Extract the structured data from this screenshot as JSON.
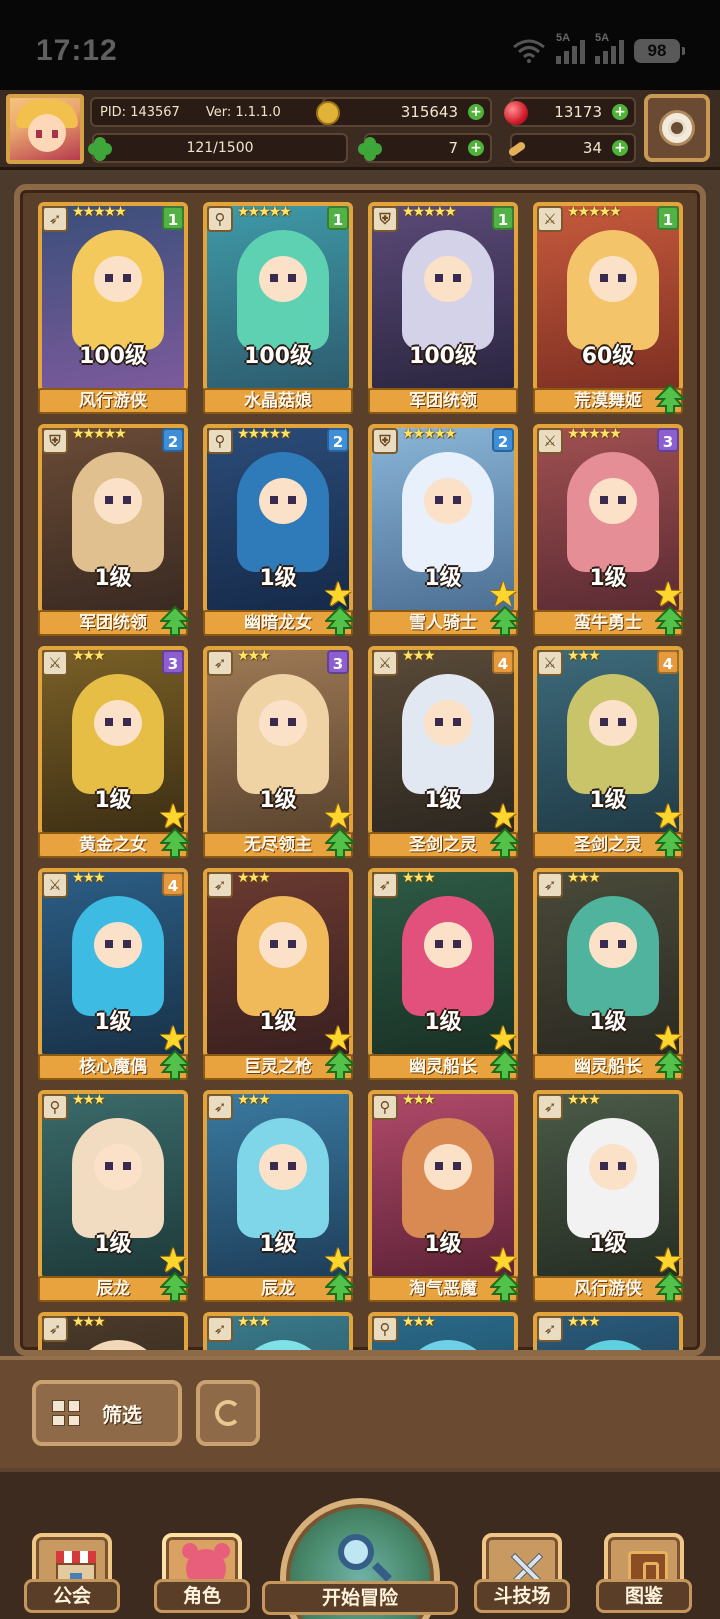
{
  "status_bar": {
    "time": "17:12",
    "sim1_label": "5A",
    "sim2_label": "5A",
    "battery": "98"
  },
  "header": {
    "pid": "PID: 143567",
    "version": "Ver: 1.1.1.0",
    "exp": "121/1500",
    "gold": "315643",
    "gems": "13173",
    "clovers": "7",
    "bones": "34",
    "plus": "+"
  },
  "heroes": [
    {
      "stars": "★★★★★",
      "tier": "1",
      "tier_class": "t1",
      "level": "100级",
      "name": "风行游侠",
      "role_icon": "bow-icon",
      "bg": [
        "#3a4f7a",
        "#7c5a9c"
      ],
      "hair": "#f3c95b",
      "upgradable": false,
      "star_ready": false,
      "upgrade_arrow": false
    },
    {
      "stars": "★★★★★",
      "tier": "1",
      "tier_class": "t1",
      "level": "100级",
      "name": "水晶菇娘",
      "role_icon": "staff-icon",
      "bg": [
        "#3f9aa8",
        "#2d5c6e"
      ],
      "hair": "#5fd1b3",
      "upgradable": false,
      "star_ready": false,
      "upgrade_arrow": false
    },
    {
      "stars": "★★★★★",
      "tier": "1",
      "tier_class": "t1",
      "level": "100级",
      "name": "军团统领",
      "role_icon": "shield-icon",
      "bg": [
        "#5b4a78",
        "#2b2640"
      ],
      "hair": "#d4d2e8",
      "upgradable": false,
      "star_ready": false,
      "upgrade_arrow": false
    },
    {
      "stars": "★★★★★",
      "tier": "1",
      "tier_class": "t1",
      "level": "60级",
      "name": "荒漠舞姬",
      "role_icon": "sword-icon",
      "bg": [
        "#c65a3c",
        "#7d2f23"
      ],
      "hair": "#f3c46a",
      "upgradable": false,
      "star_ready": false,
      "upgrade_arrow": true
    },
    {
      "stars": "★★★★★",
      "tier": "2",
      "tier_class": "t2",
      "level": "1级",
      "name": "军团统领",
      "role_icon": "shield-icon",
      "bg": [
        "#6a4b36",
        "#3a2a22"
      ],
      "hair": "#e0c08f",
      "upgradable": false,
      "star_ready": false,
      "upgrade_arrow": true
    },
    {
      "stars": "★★★★★",
      "tier": "2",
      "tier_class": "t2",
      "level": "1级",
      "name": "幽暗龙女",
      "role_icon": "staff-icon",
      "bg": [
        "#2b4c79",
        "#162a4a"
      ],
      "hair": "#2f7ab8",
      "upgradable": false,
      "star_ready": true,
      "upgrade_arrow": true
    },
    {
      "stars": "★★★★★",
      "tier": "2",
      "tier_class": "t2",
      "level": "1级",
      "name": "雪人骑士",
      "role_icon": "shield-icon",
      "bg": [
        "#8ab6d8",
        "#4d6f94"
      ],
      "hair": "#e8f0fb",
      "upgradable": false,
      "star_ready": true,
      "upgrade_arrow": true
    },
    {
      "stars": "★★★★★",
      "tier": "3",
      "tier_class": "t3",
      "level": "1级",
      "name": "蛮牛勇士",
      "role_icon": "sword-icon",
      "bg": [
        "#a05050",
        "#5a2b33"
      ],
      "hair": "#e58e95",
      "upgradable": false,
      "star_ready": true,
      "upgrade_arrow": true
    },
    {
      "stars": "★★★",
      "tier": "3",
      "tier_class": "t3",
      "level": "1级",
      "name": "黄金之女",
      "role_icon": "sword-icon",
      "bg": [
        "#7a6027",
        "#3d2f14"
      ],
      "hair": "#e6bd45",
      "upgradable": false,
      "star_ready": true,
      "upgrade_arrow": true
    },
    {
      "stars": "★★★",
      "tier": "3",
      "tier_class": "t3",
      "level": "1级",
      "name": "无尽领主",
      "role_icon": "bow-icon",
      "bg": [
        "#9e7a56",
        "#5b442f"
      ],
      "hair": "#efd3a5",
      "upgradable": false,
      "star_ready": true,
      "upgrade_arrow": true
    },
    {
      "stars": "★★★",
      "tier": "4",
      "tier_class": "t4",
      "level": "1级",
      "name": "圣剑之灵",
      "role_icon": "sword-icon",
      "bg": [
        "#5a4a38",
        "#2c2720"
      ],
      "hair": "#e2e8f2",
      "upgradable": false,
      "star_ready": true,
      "upgrade_arrow": true
    },
    {
      "stars": "★★★",
      "tier": "4",
      "tier_class": "t4",
      "level": "1级",
      "name": "圣剑之灵",
      "role_icon": "sword-icon",
      "bg": [
        "#3d6a7a",
        "#213c48"
      ],
      "hair": "#c9c46a",
      "upgradable": false,
      "star_ready": true,
      "upgrade_arrow": true
    },
    {
      "stars": "★★★",
      "tier": "4",
      "tier_class": "t4",
      "level": "1级",
      "name": "核心魔偶",
      "role_icon": "sword-icon",
      "bg": [
        "#2c5e86",
        "#183248"
      ],
      "hair": "#3dbbe3",
      "upgradable": false,
      "star_ready": true,
      "upgrade_arrow": true
    },
    {
      "stars": "★★★",
      "tier": "",
      "tier_class": "",
      "level": "1级",
      "name": "巨灵之枪",
      "role_icon": "bow-icon",
      "bg": [
        "#6a3a30",
        "#3a2020"
      ],
      "hair": "#f0b95a",
      "upgradable": false,
      "star_ready": true,
      "upgrade_arrow": true
    },
    {
      "stars": "★★★",
      "tier": "",
      "tier_class": "",
      "level": "1级",
      "name": "幽灵船长",
      "role_icon": "bow-icon",
      "bg": [
        "#2e5a44",
        "#193226"
      ],
      "hair": "#e2507c",
      "upgradable": false,
      "star_ready": true,
      "upgrade_arrow": true
    },
    {
      "stars": "★★★",
      "tier": "",
      "tier_class": "",
      "level": "1级",
      "name": "幽灵船长",
      "role_icon": "bow-icon",
      "bg": [
        "#4a4a3a",
        "#2a2a22"
      ],
      "hair": "#4fb39e",
      "upgradable": false,
      "star_ready": true,
      "upgrade_arrow": true
    },
    {
      "stars": "★★★",
      "tier": "",
      "tier_class": "",
      "level": "1级",
      "name": "辰龙",
      "role_icon": "staff-icon",
      "bg": [
        "#3b6a6a",
        "#1e3a3a"
      ],
      "hair": "#f1dcc2",
      "upgradable": false,
      "star_ready": true,
      "upgrade_arrow": true
    },
    {
      "stars": "★★★",
      "tier": "",
      "tier_class": "",
      "level": "1级",
      "name": "辰龙",
      "role_icon": "bow-icon",
      "bg": [
        "#3a7aa0",
        "#1e3e5a"
      ],
      "hair": "#7ed6e8",
      "upgradable": false,
      "star_ready": true,
      "upgrade_arrow": true
    },
    {
      "stars": "★★★",
      "tier": "",
      "tier_class": "",
      "level": "1级",
      "name": "淘气恶魔",
      "role_icon": "staff-icon",
      "bg": [
        "#b04a6a",
        "#5e2236"
      ],
      "hair": "#d98a52",
      "upgradable": false,
      "star_ready": true,
      "upgrade_arrow": true
    },
    {
      "stars": "★★★",
      "tier": "",
      "tier_class": "",
      "level": "1级",
      "name": "风行游侠",
      "role_icon": "bow-icon",
      "bg": [
        "#4a5a48",
        "#262e24"
      ],
      "hair": "#f2f2f2",
      "upgradable": false,
      "star_ready": true,
      "upgrade_arrow": true
    },
    {
      "stars": "★★★",
      "tier": "",
      "tier_class": "",
      "level": "",
      "name": "",
      "role_icon": "bow-icon",
      "bg": [
        "#4a3a2a",
        "#2a2018"
      ],
      "hair": "#f0d8b8",
      "upgradable": false,
      "star_ready": false,
      "upgrade_arrow": false
    },
    {
      "stars": "★★★",
      "tier": "",
      "tier_class": "",
      "level": "",
      "name": "",
      "role_icon": "bow-icon",
      "bg": [
        "#3a7a8a",
        "#1e4250"
      ],
      "hair": "#7fe0e8",
      "upgradable": false,
      "star_ready": false,
      "upgrade_arrow": false
    },
    {
      "stars": "★★★",
      "tier": "",
      "tier_class": "",
      "level": "",
      "name": "",
      "role_icon": "staff-icon",
      "bg": [
        "#2a6a8a",
        "#163a4a"
      ],
      "hair": "#6fd0e8",
      "upgradable": false,
      "star_ready": false,
      "upgrade_arrow": false
    },
    {
      "stars": "★★★",
      "tier": "",
      "tier_class": "",
      "level": "",
      "name": "",
      "role_icon": "bow-icon",
      "bg": [
        "#2a5a7a",
        "#162e40"
      ],
      "hair": "#5fd0e0",
      "upgradable": false,
      "star_ready": false,
      "upgrade_arrow": false
    }
  ],
  "role_glyphs": {
    "bow-icon": "➶",
    "staff-icon": "⚲",
    "shield-icon": "⛨",
    "sword-icon": "⚔"
  },
  "bottom": {
    "filter_label": "筛选"
  },
  "nav": {
    "guild": "公会",
    "role": "角色",
    "adventure": "开始冒险",
    "arena": "斗技场",
    "codex": "图鉴"
  }
}
